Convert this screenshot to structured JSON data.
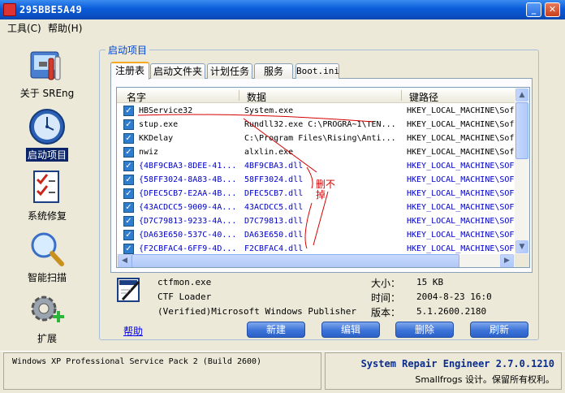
{
  "window": {
    "title": "295BBE5A49"
  },
  "menu": [
    {
      "label": "工具(C)"
    },
    {
      "label": "帮助(H)"
    }
  ],
  "nav": [
    {
      "label": "关于 SREng",
      "icon": "tools-icon"
    },
    {
      "label": "启动项目",
      "icon": "clock-icon",
      "active": true
    },
    {
      "label": "系统修复",
      "icon": "checklist-icon"
    },
    {
      "label": "智能扫描",
      "icon": "magnifier-icon"
    },
    {
      "label": "扩展",
      "icon": "gear-plus-icon"
    }
  ],
  "group": {
    "title": "启动项目"
  },
  "tabs": [
    {
      "label": "注册表",
      "active": true
    },
    {
      "label": "启动文件夹"
    },
    {
      "label": "计划任务"
    },
    {
      "label": "服务"
    },
    {
      "label": "Boot.ini"
    }
  ],
  "list": {
    "columns": [
      "名字",
      "数据",
      "键路径"
    ],
    "rows": [
      {
        "name": "HBService32",
        "data": "System.exe",
        "path": "HKEY_LOCAL_MACHINE\\Sof",
        "checked": true,
        "color": "#000000"
      },
      {
        "name": "stup.exe",
        "data": "Rundll32.exe C:\\PROGRA~1\\TEN...",
        "path": "HKEY_LOCAL_MACHINE\\Sof",
        "checked": true,
        "color": "#000000"
      },
      {
        "name": "KKDelay",
        "data": "C:\\Program Files\\Rising\\Anti...",
        "path": "HKEY_LOCAL_MACHINE\\Sof",
        "checked": true,
        "color": "#000000"
      },
      {
        "name": "nwiz",
        "data": "alxlin.exe",
        "path": "HKEY_LOCAL_MACHINE\\Sof",
        "checked": true,
        "color": "#000000"
      },
      {
        "name": "{4BF9CBA3-8DEE-41...",
        "data": "4BF9CBA3.dll",
        "path": "HKEY_LOCAL_MACHINE\\SOF",
        "checked": true,
        "color": "#0000c8"
      },
      {
        "name": "{58FF3024-8A83-4B...",
        "data": "58FF3024.dll",
        "path": "HKEY_LOCAL_MACHINE\\SOF",
        "checked": true,
        "color": "#0000c8"
      },
      {
        "name": "{DFEC5CB7-E2AA-4B...",
        "data": "DFEC5CB7.dll",
        "path": "HKEY_LOCAL_MACHINE\\SOF",
        "checked": true,
        "color": "#0000c8"
      },
      {
        "name": "{43ACDCC5-9009-4A...",
        "data": "43ACDCC5.dll",
        "path": "HKEY_LOCAL_MACHINE\\SOF",
        "checked": true,
        "color": "#0000c8"
      },
      {
        "name": "{D7C79813-9233-4A...",
        "data": "D7C79813.dll",
        "path": "HKEY_LOCAL_MACHINE\\SOF",
        "checked": true,
        "color": "#0000c8"
      },
      {
        "name": "{DA63E650-537C-40...",
        "data": "DA63E650.dll",
        "path": "HKEY_LOCAL_MACHINE\\SOF",
        "checked": true,
        "color": "#0000c8"
      },
      {
        "name": "{F2CBFAC4-6FF9-4D...",
        "data": "F2CBFAC4.dll",
        "path": "HKEY_LOCAL_MACHINE\\SOF",
        "checked": true,
        "color": "#0000c8"
      }
    ]
  },
  "annotation": {
    "text": "删不掉",
    "color": "#d40000"
  },
  "details": {
    "filename": "ctfmon.exe",
    "description": "CTF Loader",
    "publisher": "(Verified)Microsoft Windows Publisher",
    "size_label": "大小：",
    "size_value": "15 KB",
    "time_label": "时间：",
    "time_value": "2004-8-23 16:0",
    "version_label": "版本：",
    "version_value": "5.1.2600.2180"
  },
  "help_link": "帮助",
  "buttons": {
    "new": "新建",
    "edit": "编辑",
    "delete": "删除",
    "refresh": "刷新"
  },
  "status": {
    "os": "Windows XP Professional Service Pack 2 (Build 2600)",
    "product": "System Repair Engineer 2.7.0.1210",
    "copyright": "Smallfrogs 设计。保留所有权利。"
  },
  "colors": {
    "accent": "#0a5bd8",
    "link": "#0000ee",
    "group_title": "#0046d5"
  }
}
